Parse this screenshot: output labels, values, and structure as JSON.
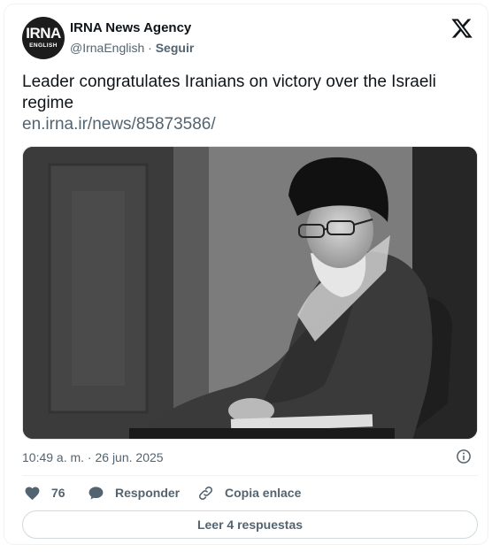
{
  "author": {
    "avatar_text": "IRNA",
    "avatar_subtext": "ENGLISH",
    "name": "IRNA News Agency",
    "handle": "@IrnaEnglish",
    "separator": " · ",
    "follow_label": "Seguir"
  },
  "header": {
    "brand_icon": "x-logo-icon"
  },
  "post": {
    "text": "Leader congratulates Iranians on victory over the Israeli regime",
    "link": "en.irna.ir/news/85873586/",
    "image_alt": "Black and white photo of an elderly cleric in a black turban and glasses, seated and writing"
  },
  "timestamp": "10:49 a. m. · 26 jun. 2025",
  "actions": {
    "like_count": "76",
    "reply_label": "Responder",
    "copy_label": "Copia enlace"
  },
  "replies_button": "Leer 4 respuestas",
  "colors": {
    "text_primary": "#0f1419",
    "text_secondary": "#536471",
    "border": "#cfd9de"
  }
}
